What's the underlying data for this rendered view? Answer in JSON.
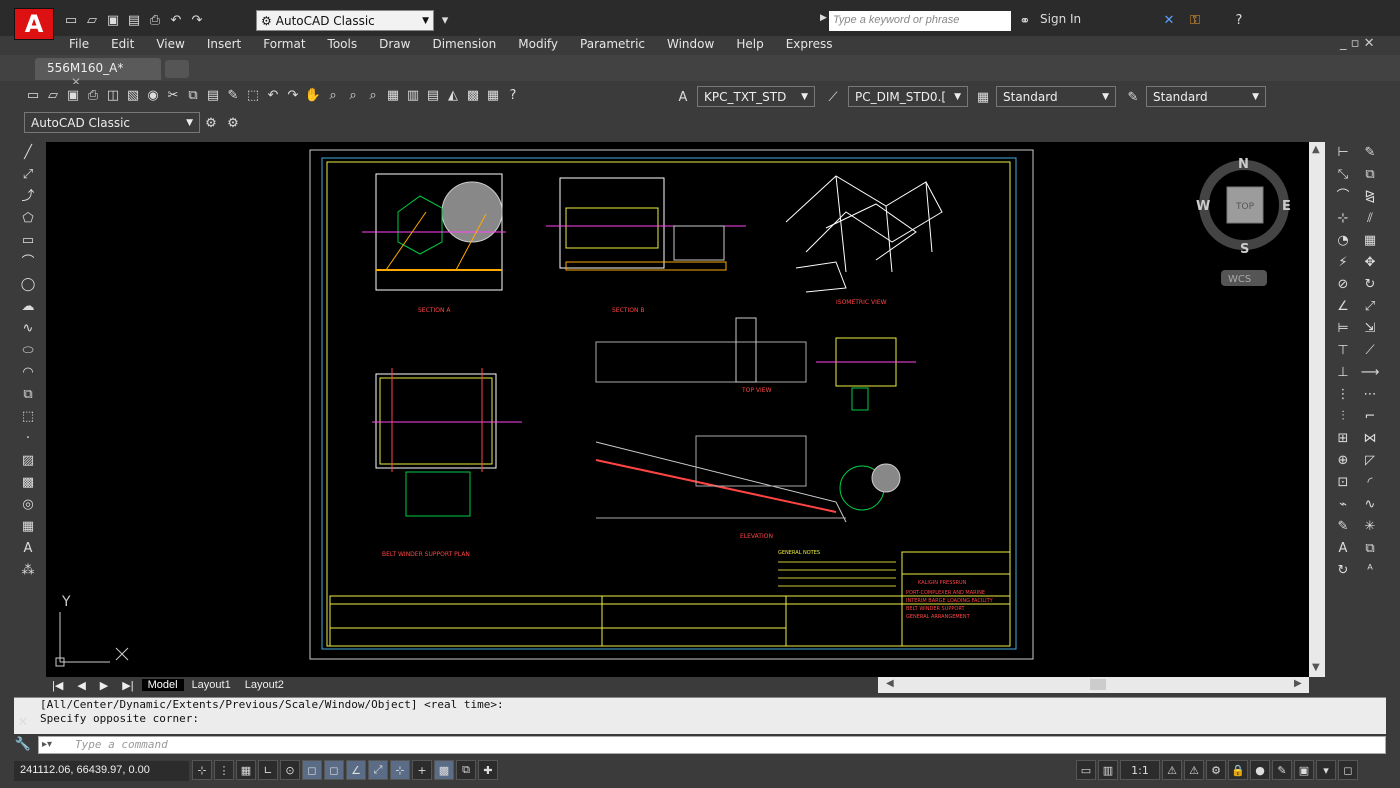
{
  "app": {
    "logo_letter": "A",
    "accent": "#d11010"
  },
  "quick_access": {
    "workspace": "AutoCAD Classic",
    "search_placeholder": "Type a keyword or phrase",
    "sign_in": "Sign In"
  },
  "menubar": [
    "File",
    "Edit",
    "View",
    "Insert",
    "Format",
    "Tools",
    "Draw",
    "Dimension",
    "Modify",
    "Parametric",
    "Window",
    "Help",
    "Express"
  ],
  "document_tab": {
    "label": "556M160_A*"
  },
  "toolbar": {
    "text_style": "KPC_TXT_STD",
    "dim_style": "PC_DIM_STD0.[",
    "table_style": "Standard",
    "multileader_style": "Standard",
    "workspace": "AutoCAD Classic"
  },
  "viewcube": {
    "north": "N",
    "south": "S",
    "east": "E",
    "west": "W",
    "face": "TOP",
    "ucs": "WCS"
  },
  "ucs_icon": {
    "y": "Y"
  },
  "drawing": {
    "section_a": "SECTION A",
    "section_b": "SECTION B",
    "isometric": "ISOMETRIC VIEW",
    "top_view": "TOP VIEW",
    "elevation": "ELEVATION",
    "plan": "BELT WINDER SUPPORT PLAN",
    "company": "KALIGIN PRESSRUN",
    "title_lines": [
      "PORT-COMPLEXER AND MARINE",
      "INTERIM BARGE LOADING FACILITY",
      "BELT WINDER SUPPORT",
      "GENERAL ARRANGEMENT"
    ],
    "notes_title": "GENERAL NOTES"
  },
  "layout_tabs": [
    "Model",
    "Layout1",
    "Layout2"
  ],
  "command": {
    "history": [
      "[All/Center/Dynamic/Extents/Previous/Scale/Window/Object] <real time>:",
      "Specify opposite corner:"
    ],
    "placeholder": "Type a command"
  },
  "status": {
    "coords": "241112.06, 66439.97, 0.00",
    "annotation_scale": "1:1"
  }
}
